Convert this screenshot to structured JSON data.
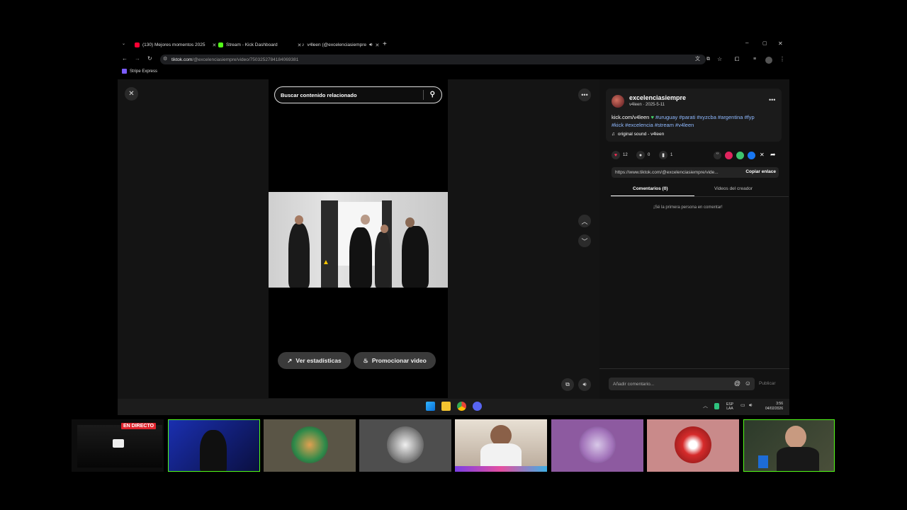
{
  "browser": {
    "tabs": [
      {
        "label": "(130) Mejores momentos 2025",
        "color": "#ff0033"
      },
      {
        "label": "Stream - Kick Dashboard",
        "color": "#53fc18"
      },
      {
        "label": "v4leen (@excelenciasiempre",
        "color": "#ffffff"
      }
    ],
    "url_host": "tiktok.com",
    "url_path": "/@excelenciasiempre/video/7503252784184069381",
    "bookmark": "Stripe Express"
  },
  "player": {
    "search_placeholder": "Buscar contenido relacionado",
    "stats_label": "Ver estadísticas",
    "promote_label": "Promocionar video"
  },
  "post": {
    "username": "excelenciasiempre",
    "subline": "v4leen · 2025-5-11",
    "desc_plain": "kick.com/v4leen",
    "hashtags_line1": "#uruguay #parati #xyzcba #argentina #fyp",
    "hashtags_line2": "#kick #excelencia #stream #v4leen",
    "sound": "original sound - v4leen",
    "likes": "12",
    "comments": "0",
    "saves": "1",
    "link": "https://www.tiktok.com/@excelenciasiempre/vide...",
    "copy_label": "Copiar enlace",
    "tab_comments": "Comentarios (0)",
    "tab_creator": "Videos del creador",
    "empty_comments": "¡Sé la primera persona en comentar!",
    "comment_placeholder": "Añadir comentario...",
    "publish_label": "Publicar"
  },
  "taskbar": {
    "lang_top": "ESP",
    "lang_bottom": "LAA",
    "time": "3:56",
    "date": "04/02/2026"
  },
  "stream": {
    "live_label": "EN DIRECTO"
  },
  "colors": {
    "accent_green": "#53fc18",
    "heart": "#fe2c55",
    "live_red": "#e0242d"
  }
}
